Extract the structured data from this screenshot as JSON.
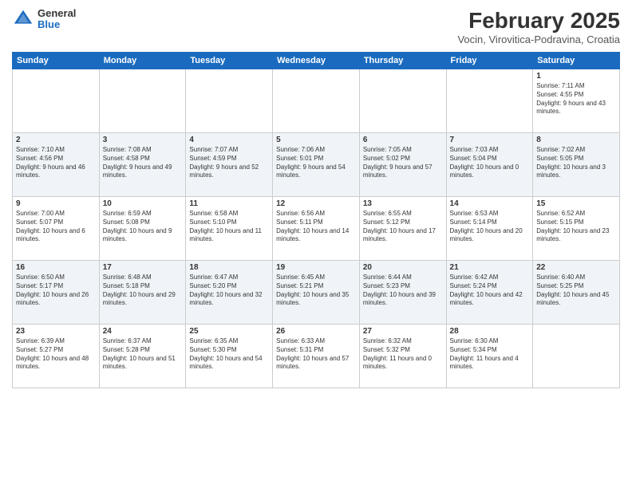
{
  "header": {
    "logo_general": "General",
    "logo_blue": "Blue",
    "title": "February 2025",
    "subtitle": "Vocin, Virovitica-Podravina, Croatia"
  },
  "days_of_week": [
    "Sunday",
    "Monday",
    "Tuesday",
    "Wednesday",
    "Thursday",
    "Friday",
    "Saturday"
  ],
  "weeks": [
    [
      {
        "day": "",
        "info": ""
      },
      {
        "day": "",
        "info": ""
      },
      {
        "day": "",
        "info": ""
      },
      {
        "day": "",
        "info": ""
      },
      {
        "day": "",
        "info": ""
      },
      {
        "day": "",
        "info": ""
      },
      {
        "day": "1",
        "info": "Sunrise: 7:11 AM\nSunset: 4:55 PM\nDaylight: 9 hours and 43 minutes."
      }
    ],
    [
      {
        "day": "2",
        "info": "Sunrise: 7:10 AM\nSunset: 4:56 PM\nDaylight: 9 hours and 46 minutes."
      },
      {
        "day": "3",
        "info": "Sunrise: 7:08 AM\nSunset: 4:58 PM\nDaylight: 9 hours and 49 minutes."
      },
      {
        "day": "4",
        "info": "Sunrise: 7:07 AM\nSunset: 4:59 PM\nDaylight: 9 hours and 52 minutes."
      },
      {
        "day": "5",
        "info": "Sunrise: 7:06 AM\nSunset: 5:01 PM\nDaylight: 9 hours and 54 minutes."
      },
      {
        "day": "6",
        "info": "Sunrise: 7:05 AM\nSunset: 5:02 PM\nDaylight: 9 hours and 57 minutes."
      },
      {
        "day": "7",
        "info": "Sunrise: 7:03 AM\nSunset: 5:04 PM\nDaylight: 10 hours and 0 minutes."
      },
      {
        "day": "8",
        "info": "Sunrise: 7:02 AM\nSunset: 5:05 PM\nDaylight: 10 hours and 3 minutes."
      }
    ],
    [
      {
        "day": "9",
        "info": "Sunrise: 7:00 AM\nSunset: 5:07 PM\nDaylight: 10 hours and 6 minutes."
      },
      {
        "day": "10",
        "info": "Sunrise: 6:59 AM\nSunset: 5:08 PM\nDaylight: 10 hours and 9 minutes."
      },
      {
        "day": "11",
        "info": "Sunrise: 6:58 AM\nSunset: 5:10 PM\nDaylight: 10 hours and 11 minutes."
      },
      {
        "day": "12",
        "info": "Sunrise: 6:56 AM\nSunset: 5:11 PM\nDaylight: 10 hours and 14 minutes."
      },
      {
        "day": "13",
        "info": "Sunrise: 6:55 AM\nSunset: 5:12 PM\nDaylight: 10 hours and 17 minutes."
      },
      {
        "day": "14",
        "info": "Sunrise: 6:53 AM\nSunset: 5:14 PM\nDaylight: 10 hours and 20 minutes."
      },
      {
        "day": "15",
        "info": "Sunrise: 6:52 AM\nSunset: 5:15 PM\nDaylight: 10 hours and 23 minutes."
      }
    ],
    [
      {
        "day": "16",
        "info": "Sunrise: 6:50 AM\nSunset: 5:17 PM\nDaylight: 10 hours and 26 minutes."
      },
      {
        "day": "17",
        "info": "Sunrise: 6:48 AM\nSunset: 5:18 PM\nDaylight: 10 hours and 29 minutes."
      },
      {
        "day": "18",
        "info": "Sunrise: 6:47 AM\nSunset: 5:20 PM\nDaylight: 10 hours and 32 minutes."
      },
      {
        "day": "19",
        "info": "Sunrise: 6:45 AM\nSunset: 5:21 PM\nDaylight: 10 hours and 35 minutes."
      },
      {
        "day": "20",
        "info": "Sunrise: 6:44 AM\nSunset: 5:23 PM\nDaylight: 10 hours and 39 minutes."
      },
      {
        "day": "21",
        "info": "Sunrise: 6:42 AM\nSunset: 5:24 PM\nDaylight: 10 hours and 42 minutes."
      },
      {
        "day": "22",
        "info": "Sunrise: 6:40 AM\nSunset: 5:25 PM\nDaylight: 10 hours and 45 minutes."
      }
    ],
    [
      {
        "day": "23",
        "info": "Sunrise: 6:39 AM\nSunset: 5:27 PM\nDaylight: 10 hours and 48 minutes."
      },
      {
        "day": "24",
        "info": "Sunrise: 6:37 AM\nSunset: 5:28 PM\nDaylight: 10 hours and 51 minutes."
      },
      {
        "day": "25",
        "info": "Sunrise: 6:35 AM\nSunset: 5:30 PM\nDaylight: 10 hours and 54 minutes."
      },
      {
        "day": "26",
        "info": "Sunrise: 6:33 AM\nSunset: 5:31 PM\nDaylight: 10 hours and 57 minutes."
      },
      {
        "day": "27",
        "info": "Sunrise: 6:32 AM\nSunset: 5:32 PM\nDaylight: 11 hours and 0 minutes."
      },
      {
        "day": "28",
        "info": "Sunrise: 6:30 AM\nSunset: 5:34 PM\nDaylight: 11 hours and 4 minutes."
      },
      {
        "day": "",
        "info": ""
      }
    ]
  ]
}
